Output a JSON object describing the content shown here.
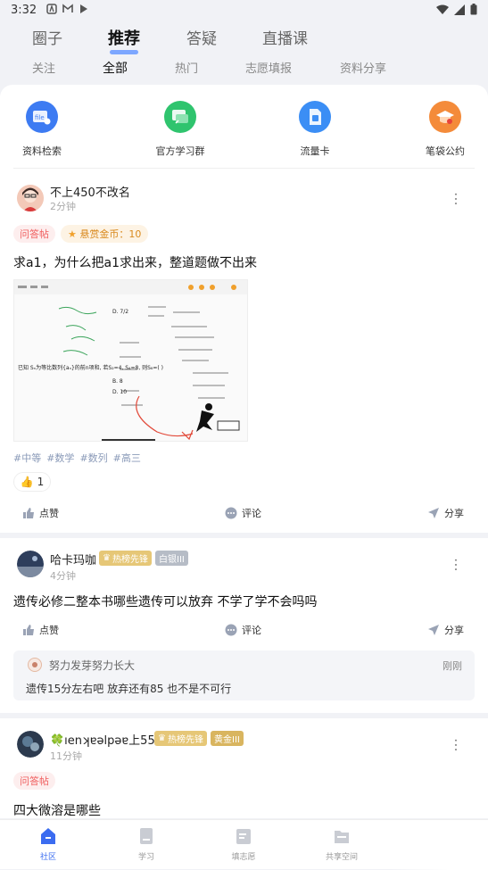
{
  "status": {
    "time": "3:32"
  },
  "top_tabs": [
    {
      "label": "圈子"
    },
    {
      "label": "推荐"
    },
    {
      "label": "答疑"
    },
    {
      "label": "直播课"
    }
  ],
  "sub_tabs": [
    {
      "label": "关注"
    },
    {
      "label": "全部"
    },
    {
      "label": "热门"
    },
    {
      "label": "志愿填报"
    },
    {
      "label": "资料分享"
    }
  ],
  "quick_links": [
    {
      "label": "资料检索",
      "icon": "file-search-icon",
      "color": "#3d7bf2"
    },
    {
      "label": "官方学习群",
      "icon": "chat-group-icon",
      "color": "#2fc46e"
    },
    {
      "label": "流量卡",
      "icon": "sim-card-icon",
      "color": "#3b8ef5"
    },
    {
      "label": "笔袋公约",
      "icon": "graduation-cap-icon",
      "color": "#f48b3a"
    }
  ],
  "post1": {
    "user": "不上450不改名",
    "time": "2分钟",
    "badge": "问答帖",
    "bounty": "悬赏金币：10",
    "title": "求a1，为什么把a1求出来，整道题做不出来",
    "image_text": "已知 Sₙ为等比数列{aₙ}的前n项和, 若S₂=4, S₄=8, 则S₈=(  )",
    "tags": [
      "#中等",
      "#数学",
      "#数列",
      "#高三"
    ],
    "likes": "1",
    "actions": {
      "like": "点赞",
      "comment": "评论",
      "share": "分享"
    }
  },
  "post2": {
    "user": "哈卡玛咖",
    "badge_hot": "热榜先锋",
    "badge_rank": "白银III",
    "time": "4分钟",
    "title": "遗传必修二整本书哪些遗传可以放弃 不学了学不会吗吗",
    "actions": {
      "like": "点赞",
      "comment": "评论",
      "share": "分享"
    },
    "reply": {
      "user": "努力发芽努力长大",
      "time": "刚刚",
      "text": "遗传15分左右吧 放弃还有85 也不是不可行"
    }
  },
  "post3": {
    "user": "🍀ıenʞɐǝlpǝɐ上550",
    "badge_hot": "热榜先锋",
    "badge_rank": "黄金III",
    "time": "11分钟",
    "badge": "问答帖",
    "title": "四大微溶是哪些"
  },
  "bottom_nav": [
    {
      "label": "社区",
      "icon": "community-icon"
    },
    {
      "label": "学习",
      "icon": "study-icon"
    },
    {
      "label": "填志愿",
      "icon": "application-icon"
    },
    {
      "label": "共享空间",
      "icon": "folder-icon"
    }
  ]
}
